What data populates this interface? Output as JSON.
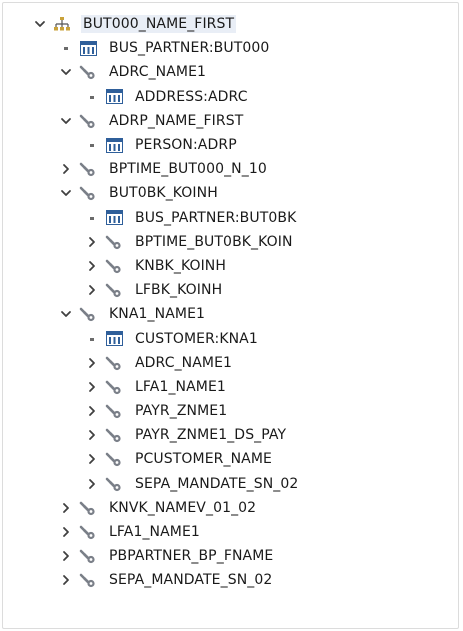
{
  "tree": {
    "rows": [
      {
        "level": 0,
        "toggle": "expanded",
        "icon": "hierarchy-icon",
        "label": "BUT000_NAME_FIRST",
        "selected": true
      },
      {
        "level": 1,
        "toggle": "leaf",
        "icon": "table-icon",
        "label": "BUS_PARTNER:BUT000"
      },
      {
        "level": 1,
        "toggle": "expanded",
        "icon": "key-icon",
        "label": "ADRC_NAME1"
      },
      {
        "level": 2,
        "toggle": "leaf",
        "icon": "table-icon",
        "label": "ADDRESS:ADRC"
      },
      {
        "level": 1,
        "toggle": "expanded",
        "icon": "key-icon",
        "label": "ADRP_NAME_FIRST"
      },
      {
        "level": 2,
        "toggle": "leaf",
        "icon": "table-icon",
        "label": "PERSON:ADRP"
      },
      {
        "level": 1,
        "toggle": "collapsed",
        "icon": "key-icon",
        "label": "BPTIME_BUT000_N_10"
      },
      {
        "level": 1,
        "toggle": "expanded",
        "icon": "key-icon",
        "label": "BUT0BK_KOINH"
      },
      {
        "level": 2,
        "toggle": "leaf",
        "icon": "table-icon",
        "label": "BUS_PARTNER:BUT0BK"
      },
      {
        "level": 2,
        "toggle": "collapsed",
        "icon": "key-icon",
        "label": "BPTIME_BUT0BK_KOIN"
      },
      {
        "level": 2,
        "toggle": "collapsed",
        "icon": "key-icon",
        "label": "KNBK_KOINH"
      },
      {
        "level": 2,
        "toggle": "collapsed",
        "icon": "key-icon",
        "label": "LFBK_KOINH"
      },
      {
        "level": 1,
        "toggle": "expanded",
        "icon": "key-icon",
        "label": "KNA1_NAME1"
      },
      {
        "level": 2,
        "toggle": "leaf",
        "icon": "table-icon",
        "label": "CUSTOMER:KNA1"
      },
      {
        "level": 2,
        "toggle": "collapsed",
        "icon": "key-icon",
        "label": "ADRC_NAME1"
      },
      {
        "level": 2,
        "toggle": "collapsed",
        "icon": "key-icon",
        "label": "LFA1_NAME1"
      },
      {
        "level": 2,
        "toggle": "collapsed",
        "icon": "key-icon",
        "label": "PAYR_ZNME1"
      },
      {
        "level": 2,
        "toggle": "collapsed",
        "icon": "key-icon",
        "label": "PAYR_ZNME1_DS_PAY"
      },
      {
        "level": 2,
        "toggle": "collapsed",
        "icon": "key-icon",
        "label": "PCUSTOMER_NAME"
      },
      {
        "level": 2,
        "toggle": "collapsed",
        "icon": "key-icon",
        "label": "SEPA_MANDATE_SN_02"
      },
      {
        "level": 1,
        "toggle": "collapsed",
        "icon": "key-icon",
        "label": "KNVK_NAMEV_01_02"
      },
      {
        "level": 1,
        "toggle": "collapsed",
        "icon": "key-icon",
        "label": "LFA1_NAME1"
      },
      {
        "level": 1,
        "toggle": "collapsed",
        "icon": "key-icon",
        "label": "PBPARTNER_BP_FNAME"
      },
      {
        "level": 1,
        "toggle": "collapsed",
        "icon": "key-icon",
        "label": "SEPA_MANDATE_SN_02"
      }
    ]
  },
  "colors": {
    "selection": "#e9eef6",
    "toggle": "#404040",
    "table_icon_blue": "#2f5f9a",
    "key_icon": "#7a7f88"
  }
}
